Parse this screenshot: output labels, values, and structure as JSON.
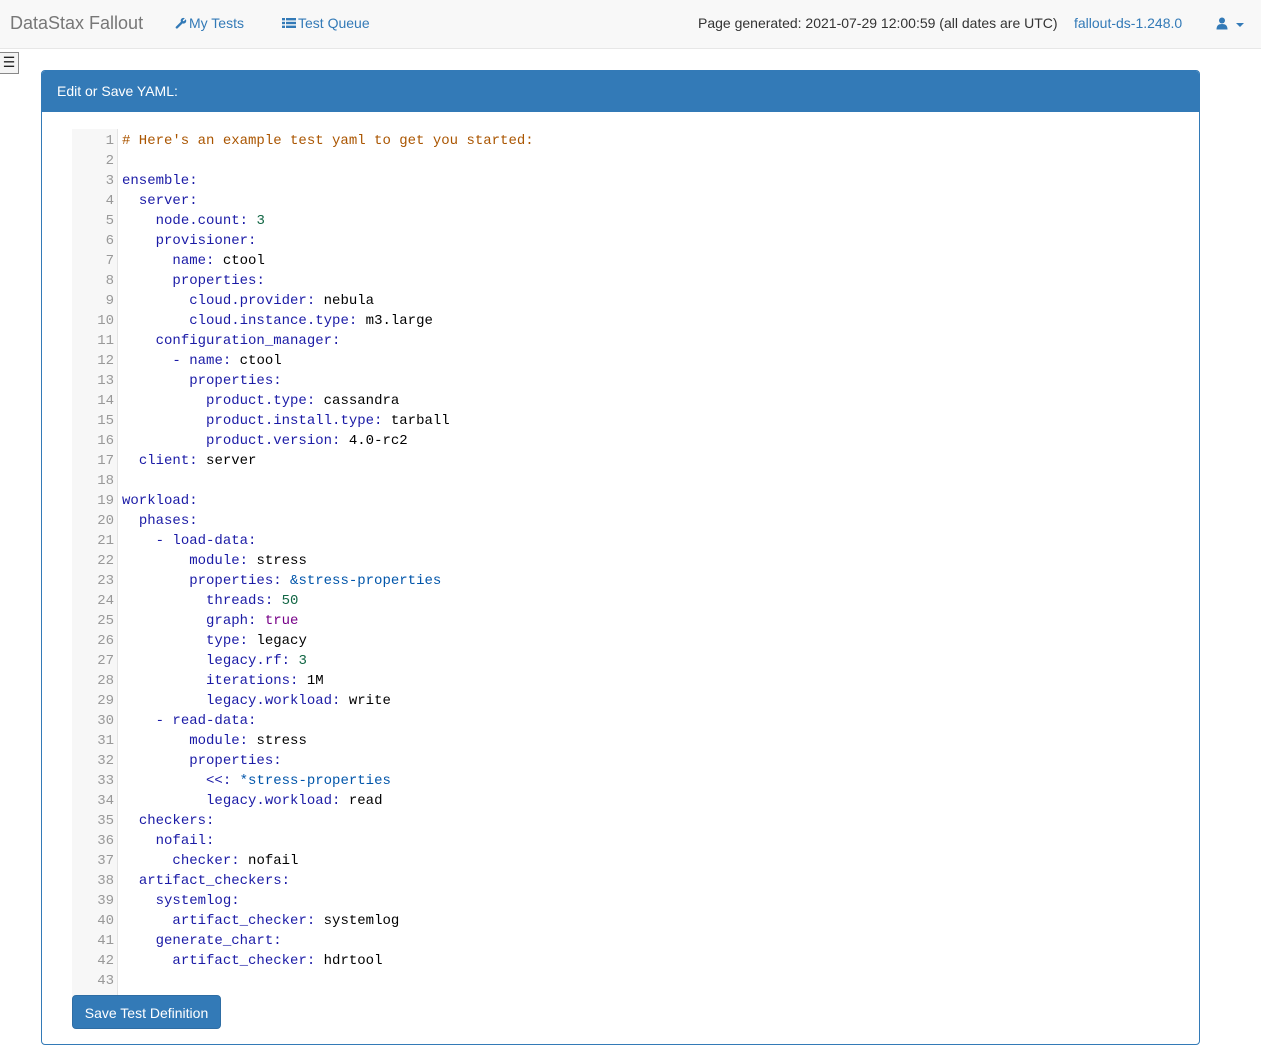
{
  "navbar": {
    "brand": "DataStax Fallout",
    "my_tests": "My Tests",
    "test_queue": "Test Queue",
    "generated": "Page generated: 2021-07-29 12:00:59 (all dates are UTC)",
    "version": "fallout-ds-1.248.0"
  },
  "sidebar_toggle": "☰",
  "panel": {
    "heading": "Edit or Save YAML:",
    "save_button": "Save Test Definition"
  },
  "colors": {
    "accent": "#337ab7",
    "comment": "#aa5500",
    "key": "#1a1aa6",
    "number": "#116644",
    "boolean": "#770088"
  },
  "editor": {
    "lines": [
      [
        [
          "c",
          "# Here's an example test yaml to get you started:"
        ]
      ],
      [],
      [
        [
          "k",
          "ensemble"
        ],
        [
          "p",
          ":"
        ]
      ],
      [
        [
          "s",
          "  "
        ],
        [
          "k",
          "server"
        ],
        [
          "p",
          ":"
        ]
      ],
      [
        [
          "s",
          "    "
        ],
        [
          "k",
          "node.count"
        ],
        [
          "p",
          ": "
        ],
        [
          "n",
          "3"
        ]
      ],
      [
        [
          "s",
          "    "
        ],
        [
          "k",
          "provisioner"
        ],
        [
          "p",
          ":"
        ]
      ],
      [
        [
          "s",
          "      "
        ],
        [
          "k",
          "name"
        ],
        [
          "p",
          ": "
        ],
        [
          "v",
          "ctool"
        ]
      ],
      [
        [
          "s",
          "      "
        ],
        [
          "k",
          "properties"
        ],
        [
          "p",
          ":"
        ]
      ],
      [
        [
          "s",
          "        "
        ],
        [
          "k",
          "cloud.provider"
        ],
        [
          "p",
          ": "
        ],
        [
          "v",
          "nebula"
        ]
      ],
      [
        [
          "s",
          "        "
        ],
        [
          "k",
          "cloud.instance.type"
        ],
        [
          "p",
          ": "
        ],
        [
          "v",
          "m3.large"
        ]
      ],
      [
        [
          "s",
          "    "
        ],
        [
          "k",
          "configuration_manager"
        ],
        [
          "p",
          ":"
        ]
      ],
      [
        [
          "s",
          "      "
        ],
        [
          "p",
          "- "
        ],
        [
          "k",
          "name"
        ],
        [
          "p",
          ": "
        ],
        [
          "v",
          "ctool"
        ]
      ],
      [
        [
          "s",
          "        "
        ],
        [
          "k",
          "properties"
        ],
        [
          "p",
          ":"
        ]
      ],
      [
        [
          "s",
          "          "
        ],
        [
          "k",
          "product.type"
        ],
        [
          "p",
          ": "
        ],
        [
          "v",
          "cassandra"
        ]
      ],
      [
        [
          "s",
          "          "
        ],
        [
          "k",
          "product.install.type"
        ],
        [
          "p",
          ": "
        ],
        [
          "v",
          "tarball"
        ]
      ],
      [
        [
          "s",
          "          "
        ],
        [
          "k",
          "product.version"
        ],
        [
          "p",
          ": "
        ],
        [
          "v",
          "4.0-rc2"
        ]
      ],
      [
        [
          "s",
          "  "
        ],
        [
          "k",
          "client"
        ],
        [
          "p",
          ": "
        ],
        [
          "v",
          "server"
        ]
      ],
      [],
      [
        [
          "k",
          "workload"
        ],
        [
          "p",
          ":"
        ]
      ],
      [
        [
          "s",
          "  "
        ],
        [
          "k",
          "phases"
        ],
        [
          "p",
          ":"
        ]
      ],
      [
        [
          "s",
          "    "
        ],
        [
          "p",
          "- "
        ],
        [
          "k",
          "load-data"
        ],
        [
          "p",
          ":"
        ]
      ],
      [
        [
          "s",
          "        "
        ],
        [
          "k",
          "module"
        ],
        [
          "p",
          ": "
        ],
        [
          "v",
          "stress"
        ]
      ],
      [
        [
          "s",
          "        "
        ],
        [
          "k",
          "properties"
        ],
        [
          "p",
          ": "
        ],
        [
          "a",
          "&stress-properties"
        ]
      ],
      [
        [
          "s",
          "          "
        ],
        [
          "k",
          "threads"
        ],
        [
          "p",
          ": "
        ],
        [
          "n",
          "50"
        ]
      ],
      [
        [
          "s",
          "          "
        ],
        [
          "k",
          "graph"
        ],
        [
          "p",
          ": "
        ],
        [
          "b",
          "true"
        ]
      ],
      [
        [
          "s",
          "          "
        ],
        [
          "k",
          "type"
        ],
        [
          "p",
          ": "
        ],
        [
          "v",
          "legacy"
        ]
      ],
      [
        [
          "s",
          "          "
        ],
        [
          "k",
          "legacy.rf"
        ],
        [
          "p",
          ": "
        ],
        [
          "n",
          "3"
        ]
      ],
      [
        [
          "s",
          "          "
        ],
        [
          "k",
          "iterations"
        ],
        [
          "p",
          ": "
        ],
        [
          "v",
          "1M"
        ]
      ],
      [
        [
          "s",
          "          "
        ],
        [
          "k",
          "legacy.workload"
        ],
        [
          "p",
          ": "
        ],
        [
          "v",
          "write"
        ]
      ],
      [
        [
          "s",
          "    "
        ],
        [
          "p",
          "- "
        ],
        [
          "k",
          "read-data"
        ],
        [
          "p",
          ":"
        ]
      ],
      [
        [
          "s",
          "        "
        ],
        [
          "k",
          "module"
        ],
        [
          "p",
          ": "
        ],
        [
          "v",
          "stress"
        ]
      ],
      [
        [
          "s",
          "        "
        ],
        [
          "k",
          "properties"
        ],
        [
          "p",
          ":"
        ]
      ],
      [
        [
          "s",
          "          "
        ],
        [
          "k",
          "<<"
        ],
        [
          "p",
          ": "
        ],
        [
          "a",
          "*stress-properties"
        ]
      ],
      [
        [
          "s",
          "          "
        ],
        [
          "k",
          "legacy.workload"
        ],
        [
          "p",
          ": "
        ],
        [
          "v",
          "read"
        ]
      ],
      [
        [
          "s",
          "  "
        ],
        [
          "k",
          "checkers"
        ],
        [
          "p",
          ":"
        ]
      ],
      [
        [
          "s",
          "    "
        ],
        [
          "k",
          "nofail"
        ],
        [
          "p",
          ":"
        ]
      ],
      [
        [
          "s",
          "      "
        ],
        [
          "k",
          "checker"
        ],
        [
          "p",
          ": "
        ],
        [
          "v",
          "nofail"
        ]
      ],
      [
        [
          "s",
          "  "
        ],
        [
          "k",
          "artifact_checkers"
        ],
        [
          "p",
          ":"
        ]
      ],
      [
        [
          "s",
          "    "
        ],
        [
          "k",
          "systemlog"
        ],
        [
          "p",
          ":"
        ]
      ],
      [
        [
          "s",
          "      "
        ],
        [
          "k",
          "artifact_checker"
        ],
        [
          "p",
          ": "
        ],
        [
          "v",
          "systemlog"
        ]
      ],
      [
        [
          "s",
          "    "
        ],
        [
          "k",
          "generate_chart"
        ],
        [
          "p",
          ":"
        ]
      ],
      [
        [
          "s",
          "      "
        ],
        [
          "k",
          "artifact_checker"
        ],
        [
          "p",
          ": "
        ],
        [
          "v",
          "hdrtool"
        ]
      ],
      []
    ]
  }
}
